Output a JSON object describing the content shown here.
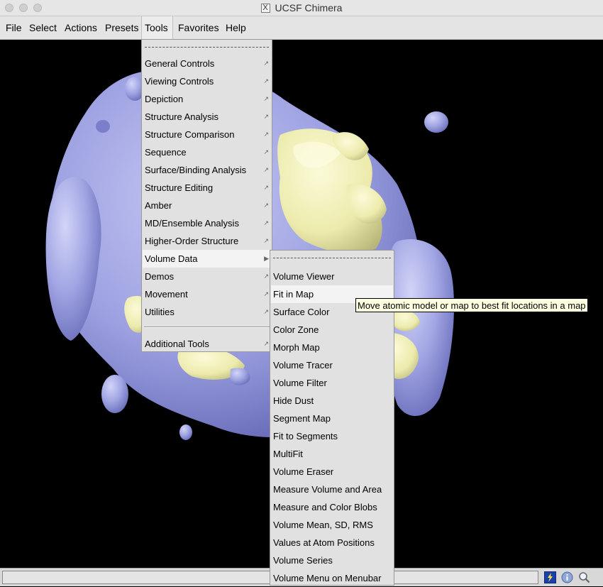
{
  "window": {
    "title": "UCSF Chimera"
  },
  "menubar": {
    "file": "File",
    "select": "Select",
    "actions": "Actions",
    "presets": "Presets",
    "tools": "Tools",
    "favorites": "Favorites",
    "help": "Help"
  },
  "tools_menu": {
    "items": [
      "General Controls",
      "Viewing Controls",
      "Depiction",
      "Structure Analysis",
      "Structure Comparison",
      "Sequence",
      "Surface/Binding Analysis",
      "Structure Editing",
      "Amber",
      "MD/Ensemble Analysis",
      "Higher-Order Structure",
      "Volume Data",
      "Demos",
      "Movement",
      "Utilities"
    ],
    "additional": "Additional Tools"
  },
  "volume_menu": {
    "items": [
      "Volume Viewer",
      "Fit in Map",
      "Surface Color",
      "Color Zone",
      "Morph Map",
      "Volume Tracer",
      "Volume Filter",
      "Hide Dust",
      "Segment Map",
      "Fit to Segments",
      "MultiFit",
      "Volume Eraser",
      "Measure Volume and Area",
      "Measure and Color Blobs",
      "Volume Mean, SD, RMS",
      "Values at Atom Positions",
      "Volume Series",
      "Volume Menu on Menubar"
    ]
  },
  "tooltip": {
    "text": "Move atomic model or map to best fit locations in a map"
  },
  "colors": {
    "surface": "#9b9fe0",
    "density": "#f0efb0",
    "background": "#000000"
  },
  "icons": [
    "lightning-icon",
    "info-icon",
    "magnifier-icon"
  ]
}
